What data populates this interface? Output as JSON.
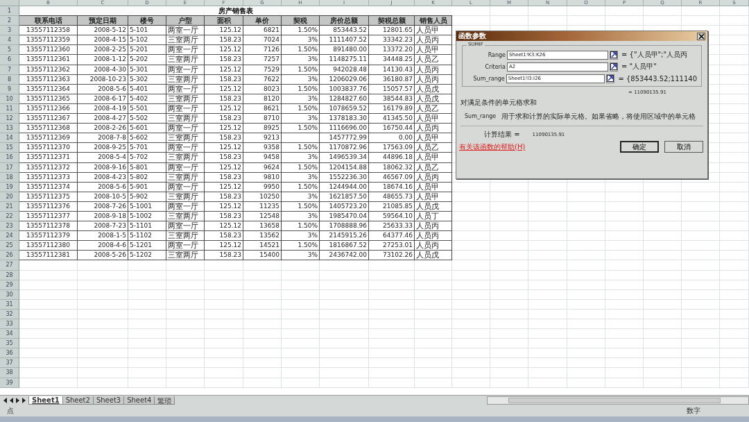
{
  "sheet": {
    "columns": [
      "B",
      "C",
      "D",
      "E",
      "F",
      "G",
      "H",
      "I",
      "J",
      "K",
      "L",
      "M",
      "N",
      "O",
      "P",
      "Q",
      "R",
      "S"
    ],
    "row_numbers": [
      "1",
      "2",
      "3",
      "4",
      "5",
      "6",
      "7",
      "8",
      "9",
      "10",
      "11",
      "12",
      "13",
      "14",
      "15",
      "16",
      "17",
      "18",
      "19",
      "20",
      "21",
      "22",
      "23",
      "24",
      "25",
      "26",
      "27",
      "28",
      "29",
      "30",
      "31",
      "32",
      "33",
      "34",
      "35",
      "36",
      "37",
      "38",
      "39"
    ],
    "title": "房产销售表",
    "headers": [
      "联系电话",
      "预定日期",
      "楼号",
      "户型",
      "面积",
      "单价",
      "契税",
      "房价总额",
      "契税总额",
      "销售人员"
    ],
    "rows": [
      [
        "13557112358",
        "2008-5-12",
        "5-101",
        "两室一厅",
        "125.12",
        "6821",
        "1.50%",
        "853443.52",
        "12801.65",
        "人员甲"
      ],
      [
        "13557112359",
        "2008-4-15",
        "5-102",
        "三室两厅",
        "158.23",
        "7024",
        "3%",
        "1111407.52",
        "33342.23",
        "人员丙"
      ],
      [
        "13557112360",
        "2008-2-25",
        "5-201",
        "两室一厅",
        "125.12",
        "7126",
        "1.50%",
        "891480.00",
        "13372.20",
        "人员甲"
      ],
      [
        "13557112361",
        "2008-1-12",
        "5-202",
        "三室两厅",
        "158.23",
        "7257",
        "3%",
        "1148275.11",
        "34448.25",
        "人员乙"
      ],
      [
        "13557112362",
        "2008-4-30",
        "5-301",
        "两室一厅",
        "125.12",
        "7529",
        "1.50%",
        "942028.48",
        "14130.43",
        "人员丙"
      ],
      [
        "13557112363",
        "2008-10-23",
        "5-302",
        "三室两厅",
        "158.23",
        "7622",
        "3%",
        "1206029.06",
        "36180.87",
        "人员丙"
      ],
      [
        "13557112364",
        "2008-5-6",
        "5-401",
        "两室一厅",
        "125.12",
        "8023",
        "1.50%",
        "1003837.76",
        "15057.57",
        "人员戊"
      ],
      [
        "13557112365",
        "2008-6-17",
        "5-402",
        "三室两厅",
        "158.23",
        "8120",
        "3%",
        "1284827.60",
        "38544.83",
        "人员戊"
      ],
      [
        "13557112366",
        "2008-4-19",
        "5-501",
        "两室一厅",
        "125.12",
        "8621",
        "1.50%",
        "1078659.52",
        "16179.89",
        "人员乙"
      ],
      [
        "13557112367",
        "2008-4-27",
        "5-502",
        "三室两厅",
        "158.23",
        "8710",
        "3%",
        "1378183.30",
        "41345.50",
        "人员甲"
      ],
      [
        "13557112368",
        "2008-2-26",
        "5-601",
        "两室一厅",
        "125.12",
        "8925",
        "1.50%",
        "1116696.00",
        "16750.44",
        "人员丙"
      ],
      [
        "13557112369",
        "2008-7-8",
        "5-602",
        "三室两厅",
        "158.23",
        "9213",
        null,
        "1457772.99",
        "0.00",
        "人员甲"
      ],
      [
        "13557112370",
        "2008-9-25",
        "5-701",
        "两室一厅",
        "125.12",
        "9358",
        "1.50%",
        "1170872.96",
        "17563.09",
        "人员乙"
      ],
      [
        "13557112371",
        "2008-5-4",
        "5-702",
        "三室两厅",
        "158.23",
        "9458",
        "3%",
        "1496539.34",
        "44896.18",
        "人员甲"
      ],
      [
        "13557112372",
        "2008-9-16",
        "5-801",
        "两室一厅",
        "125.12",
        "9624",
        "1.50%",
        "1204154.88",
        "18062.32",
        "人员乙"
      ],
      [
        "13557112373",
        "2008-4-23",
        "5-802",
        "三室两厅",
        "158.23",
        "9810",
        "3%",
        "1552236.30",
        "46567.09",
        "人员丙"
      ],
      [
        "13557112374",
        "2008-5-6",
        "5-901",
        "两室一厅",
        "125.12",
        "9950",
        "1.50%",
        "1244944.00",
        "18674.16",
        "人员甲"
      ],
      [
        "13557112375",
        "2008-10-5",
        "5-902",
        "三室两厅",
        "158.23",
        "10250",
        "3%",
        "1621857.50",
        "48655.73",
        "人员甲"
      ],
      [
        "13557112376",
        "2008-7-26",
        "5-1001",
        "两室一厅",
        "125.12",
        "11235",
        "1.50%",
        "1405723.20",
        "21085.85",
        "人员戊"
      ],
      [
        "13557112377",
        "2008-9-18",
        "5-1002",
        "三室两厅",
        "158.23",
        "12548",
        "3%",
        "1985470.04",
        "59564.10",
        "人员丁"
      ],
      [
        "13557112378",
        "2008-7-23",
        "5-1101",
        "两室一厅",
        "125.12",
        "13658",
        "1.50%",
        "1708888.96",
        "25633.33",
        "人员丙"
      ],
      [
        "13557112379",
        "2008-1-5",
        "5-1102",
        "三室两厅",
        "158.23",
        "13562",
        "3%",
        "2145915.26",
        "64377.46",
        "人员丙"
      ],
      [
        "13557112380",
        "2008-4-6",
        "5-1201",
        "两室一厅",
        "125.12",
        "14521",
        "1.50%",
        "1816867.52",
        "27253.01",
        "人员丙"
      ],
      [
        "13557112381",
        "2008-5-26",
        "5-1202",
        "三室两厅",
        "158.23",
        "15400",
        "3%",
        "2436742.00",
        "73102.26",
        "人员戊"
      ]
    ]
  },
  "dialog": {
    "title": "函数参数",
    "function": "SUMIF",
    "arguments": [
      {
        "label": "Range",
        "value": "Sheet1!K3:K26",
        "result": "= {\"人员甲\";\"人员丙"
      },
      {
        "label": "Criteria",
        "value": "A2",
        "result": "= \"人员甲\""
      },
      {
        "label": "Sum_range",
        "value": "Sheet1!I3:I26",
        "result": "= {853443.52;111140"
      }
    ],
    "total": "= 11090135.91",
    "description": "对满足条件的单元格求和",
    "argument_name": "Sum_range",
    "argument_help": "用于求和计算的实际单元格。如果省略，将使用区域中的单元格",
    "result_label": "计算结果 =",
    "result_value": "11090135.91",
    "help_link": "有关该函数的帮助(H)",
    "buttons": [
      "确定",
      "取消"
    ]
  },
  "sheet_tabs": [
    {
      "label": "Sheet1",
      "selected": true
    },
    {
      "label": "Sheet2",
      "selected": false
    },
    {
      "label": "Sheet3",
      "selected": false
    },
    {
      "label": "Sheet4",
      "selected": false
    },
    {
      "label": "繁琐",
      "selected": false
    }
  ],
  "status_bar": {
    "left": "点",
    "right": "数字"
  }
}
